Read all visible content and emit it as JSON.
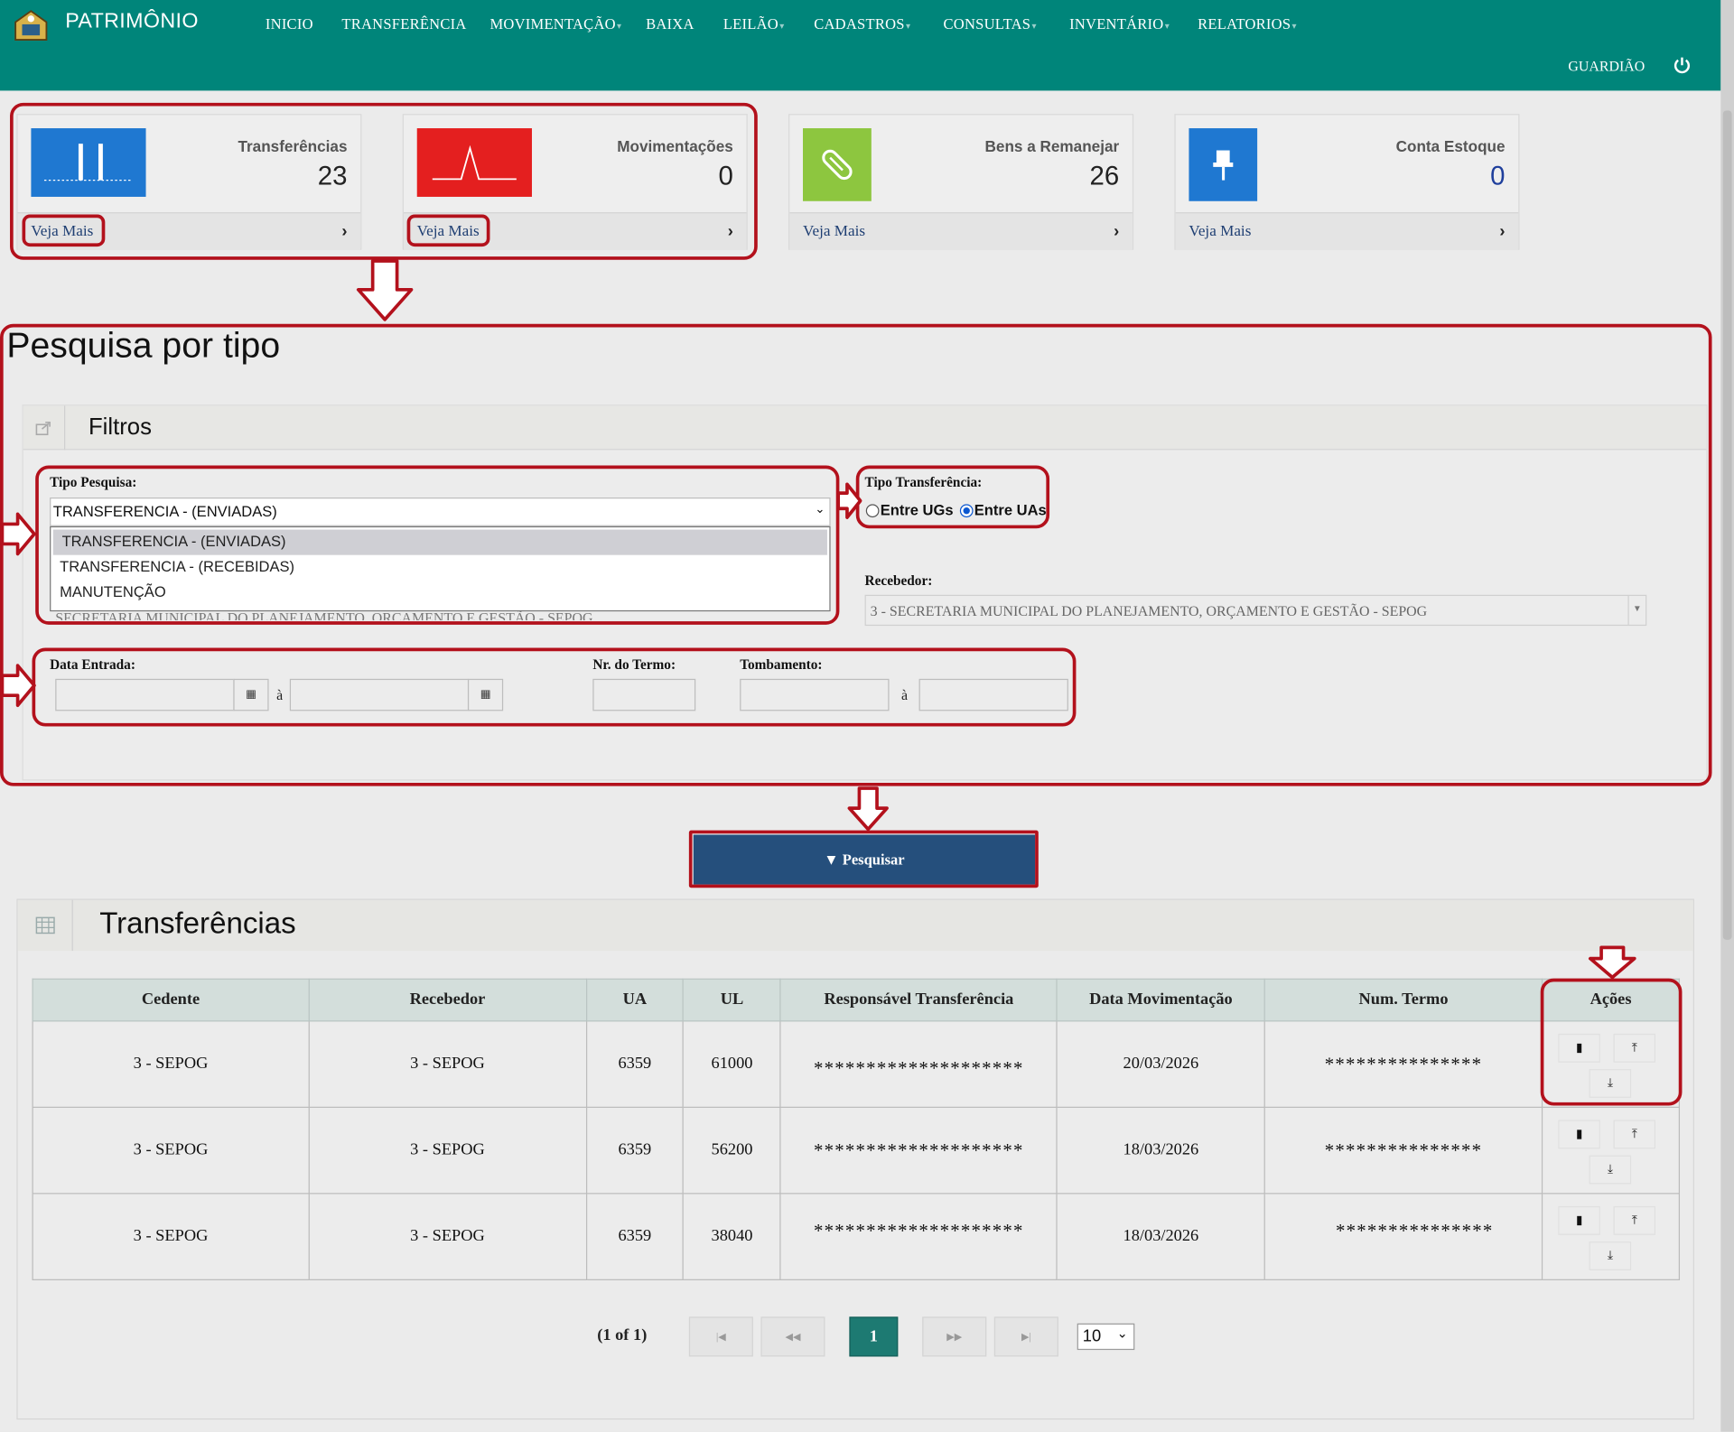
{
  "header": {
    "brand": "PATRIMÔNIO",
    "nav": [
      {
        "label": "INICIO",
        "caret": false
      },
      {
        "label": "TRANSFERÊNCIA",
        "caret": false
      },
      {
        "label": "MOVIMENTAÇÃO",
        "caret": true
      },
      {
        "label": "BAIXA",
        "caret": false
      },
      {
        "label": "LEILÃO",
        "caret": true
      },
      {
        "label": "CADASTROS",
        "caret": true
      },
      {
        "label": "CONSULTAS",
        "caret": true
      },
      {
        "label": "INVENTÁRIO",
        "caret": true
      },
      {
        "label": "RELATORIOS",
        "caret": true
      }
    ],
    "user": "GUARDIÃO",
    "colors": {
      "bar": "#00857a"
    }
  },
  "cards": [
    {
      "label": "Transferências",
      "count": "23",
      "more": "Veja Mais",
      "icon": "bar-chart-icon",
      "color": "#1f78d1"
    },
    {
      "label": "Movimentações",
      "count": "0",
      "more": "Veja Mais",
      "icon": "pulse-chart-icon",
      "color": "#e41f1f"
    },
    {
      "label": "Bens a Remanejar",
      "count": "26",
      "more": "Veja Mais",
      "icon": "paperclip-icon",
      "color": "#8dc63f"
    },
    {
      "label": "Conta Estoque",
      "count": "0",
      "more": "Veja Mais",
      "icon": "pin-icon",
      "color": "#1f78d1"
    }
  ],
  "search": {
    "title": "Pesquisa por tipo",
    "panel_title": "Filtros",
    "tipo_pesquisa_label": "Tipo Pesquisa:",
    "tipo_pesquisa_value": "TRANSFERENCIA - (ENVIADAS)",
    "tipo_pesquisa_options": [
      "TRANSFERENCIA - (ENVIADAS)",
      "TRANSFERENCIA - (RECEBIDAS)",
      "MANUTENÇÃO"
    ],
    "hidden_cedente": "SECRETARIA MUNICIPAL DO PLANEJAMENTO, ORÇAMENTO E GESTÃO - SEPOG",
    "tipo_transferencia_label": "Tipo Transferência:",
    "radio_ugs": "Entre UGs",
    "radio_uas": "Entre UAs",
    "radio_selected": "Entre UAs",
    "recebedor_label": "Recebedor:",
    "recebedor_value": "3 - SECRETARIA MUNICIPAL DO PLANEJAMENTO, ORÇAMENTO E GESTÃO - SEPOG",
    "data_entrada_label": "Data Entrada:",
    "nr_termo_label": "Nr. do Termo:",
    "tombamento_label": "Tombamento:",
    "between": "à",
    "button": "Pesquisar"
  },
  "results": {
    "title": "Transferências",
    "columns": [
      "Cedente",
      "Recebedor",
      "UA",
      "UL",
      "Responsável Transferência",
      "Data Movimentação",
      "Num. Termo",
      "Ações"
    ],
    "rows": [
      [
        "3 - SEPOG",
        "3 - SEPOG",
        "6359",
        "61000",
        "********************",
        "20/03/2026",
        "***************"
      ],
      [
        "3 - SEPOG",
        "3 - SEPOG",
        "6359",
        "56200",
        "********************",
        "18/03/2026",
        "***************"
      ],
      [
        "3 - SEPOG",
        "3 - SEPOG",
        "6359",
        "38040",
        "********************",
        "18/03/2026",
        "***************"
      ]
    ],
    "pager_info": "(1 of 1)",
    "current_page": "1",
    "rows_per_page": "10"
  }
}
